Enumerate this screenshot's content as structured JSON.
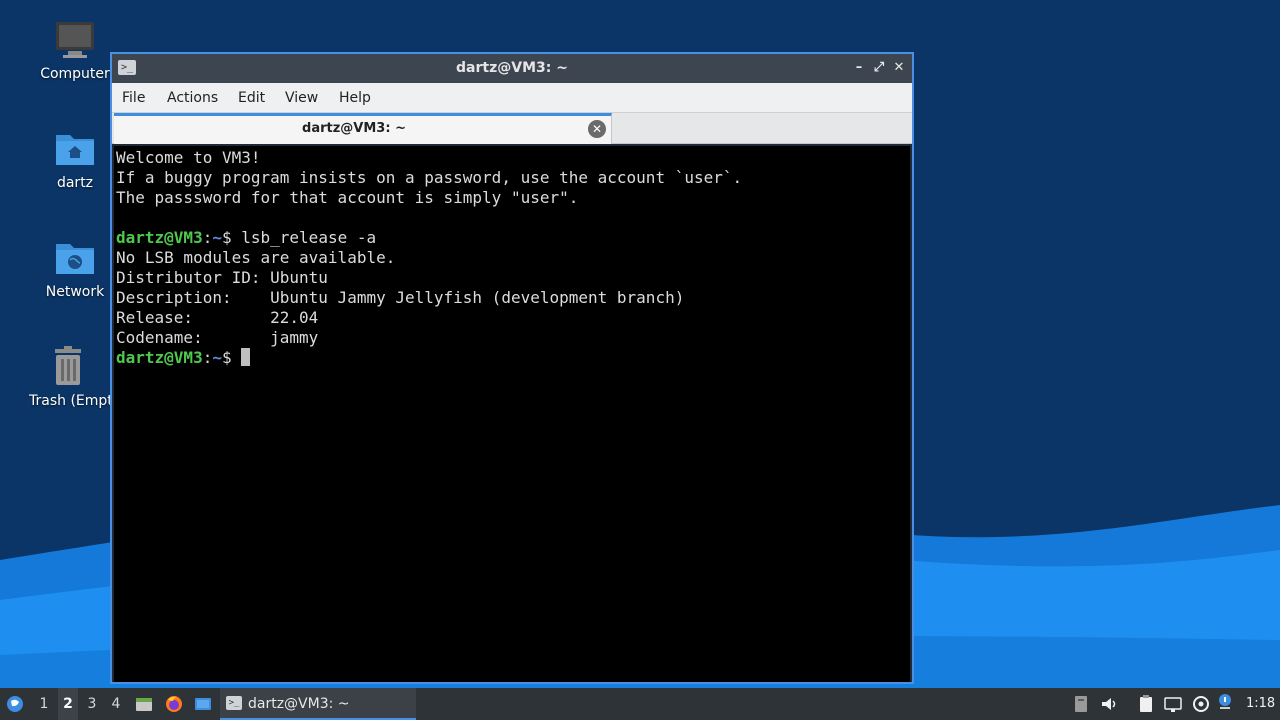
{
  "desktop": {
    "icons": [
      {
        "label": "Computer",
        "icon": "computer-icon"
      },
      {
        "label": "dartz",
        "icon": "home-folder-icon"
      },
      {
        "label": "Network",
        "icon": "network-folder-icon"
      },
      {
        "label": "Trash (Empty)",
        "icon": "trash-icon"
      }
    ]
  },
  "window": {
    "title": "dartz@VM3: ~",
    "controls": {
      "minimize": "–",
      "maximize": "⤢",
      "close": "✕"
    },
    "menu": [
      "File",
      "Actions",
      "Edit",
      "View",
      "Help"
    ],
    "tab": {
      "title": "dartz@VM3: ~",
      "close": "✕"
    }
  },
  "terminal": {
    "lines": [
      "Welcome to VM3!",
      "If a buggy program insists on a password, use the account `user`.",
      "The passsword for that account is simply \"user\".",
      "",
      "No LSB modules are available.",
      "Distributor ID: Ubuntu",
      "Description:    Ubuntu Jammy Jellyfish (development branch)",
      "Release:        22.04",
      "Codename:       jammy"
    ],
    "prompt_user": "dartz@VM3",
    "prompt_sep": ":",
    "prompt_path": "~",
    "prompt_symbol": "$ ",
    "command": "lsb_release -a"
  },
  "taskbar": {
    "workspaces": [
      "1",
      "2",
      "3",
      "4"
    ],
    "active_workspace": "2",
    "task_label": "dartz@VM3: ~",
    "clock": "1:18"
  },
  "colors": {
    "accent": "#4a90e2",
    "prompt_user": "#4ec94e",
    "prompt_path": "#5b8de0",
    "terminal_bg": "#000000",
    "terminal_fg": "#dcdcdc"
  }
}
